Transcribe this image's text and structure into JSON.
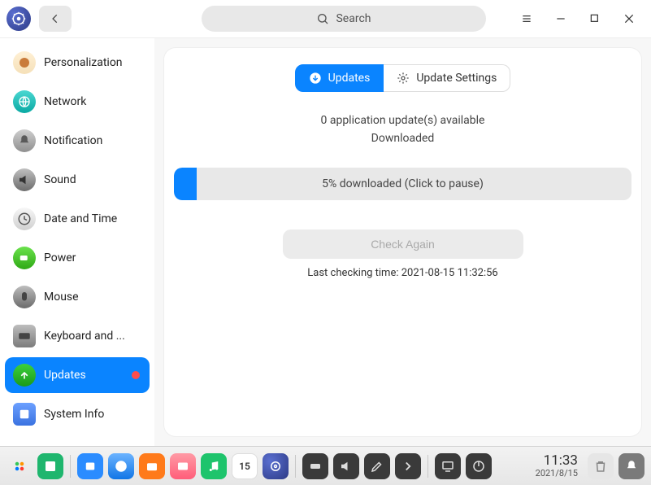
{
  "header": {
    "search_placeholder": "Search"
  },
  "sidebar": {
    "items": [
      {
        "label": "Personalization"
      },
      {
        "label": "Network"
      },
      {
        "label": "Notification"
      },
      {
        "label": "Sound"
      },
      {
        "label": "Date and Time"
      },
      {
        "label": "Power"
      },
      {
        "label": "Mouse"
      },
      {
        "label": "Keyboard and ..."
      },
      {
        "label": "Updates",
        "active": true,
        "badge": true
      },
      {
        "label": "System Info"
      }
    ]
  },
  "tabs": {
    "updates": "Updates",
    "settings": "Update Settings"
  },
  "status": {
    "line1": "0 application update(s) available",
    "line2": "Downloaded"
  },
  "progress": {
    "percent": 5,
    "label": "5% downloaded (Click to pause)"
  },
  "check_button": "Check Again",
  "last_check": "Last checking time: 2021-08-15 11:32:56",
  "taskbar": {
    "time": "11:33",
    "date": "2021/8/15",
    "day": "15"
  }
}
